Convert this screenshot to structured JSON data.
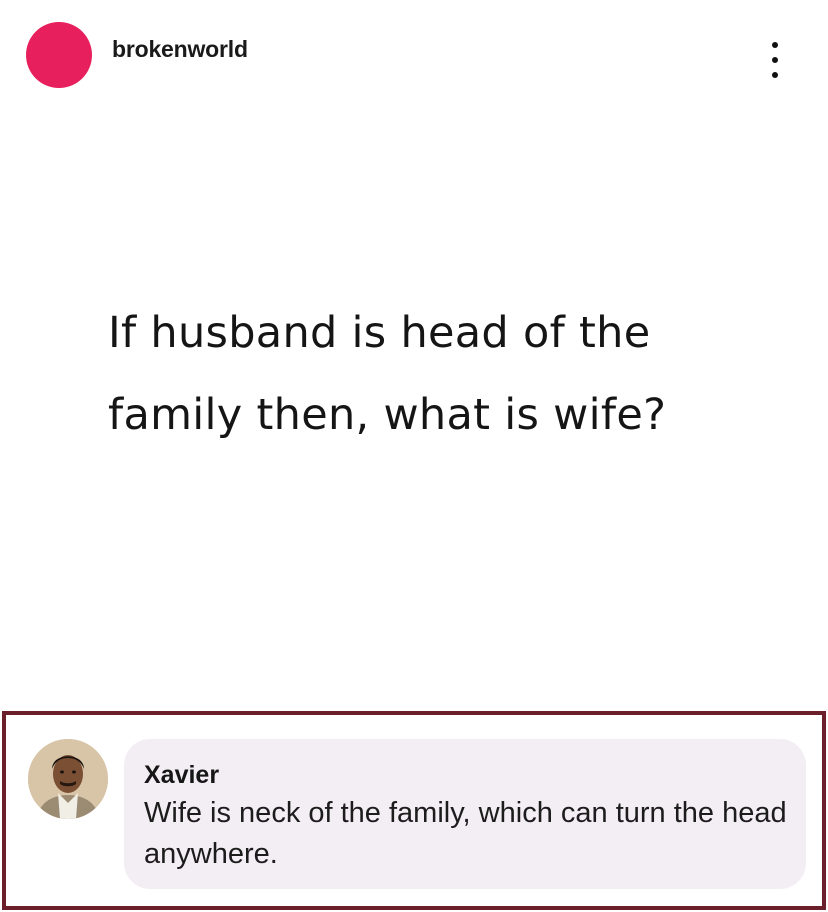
{
  "post": {
    "username": "brokenworld",
    "avatar_color": "#e81f5d",
    "menu_icon": "more-vertical-icon",
    "text": "If husband is head of the family then, what is wife?"
  },
  "comment": {
    "author": "Xavier",
    "text": "Wife is neck of the family, which can turn the head anywhere.",
    "highlight_border_color": "#6b1f2a",
    "bubble_color": "#f3eef3"
  }
}
